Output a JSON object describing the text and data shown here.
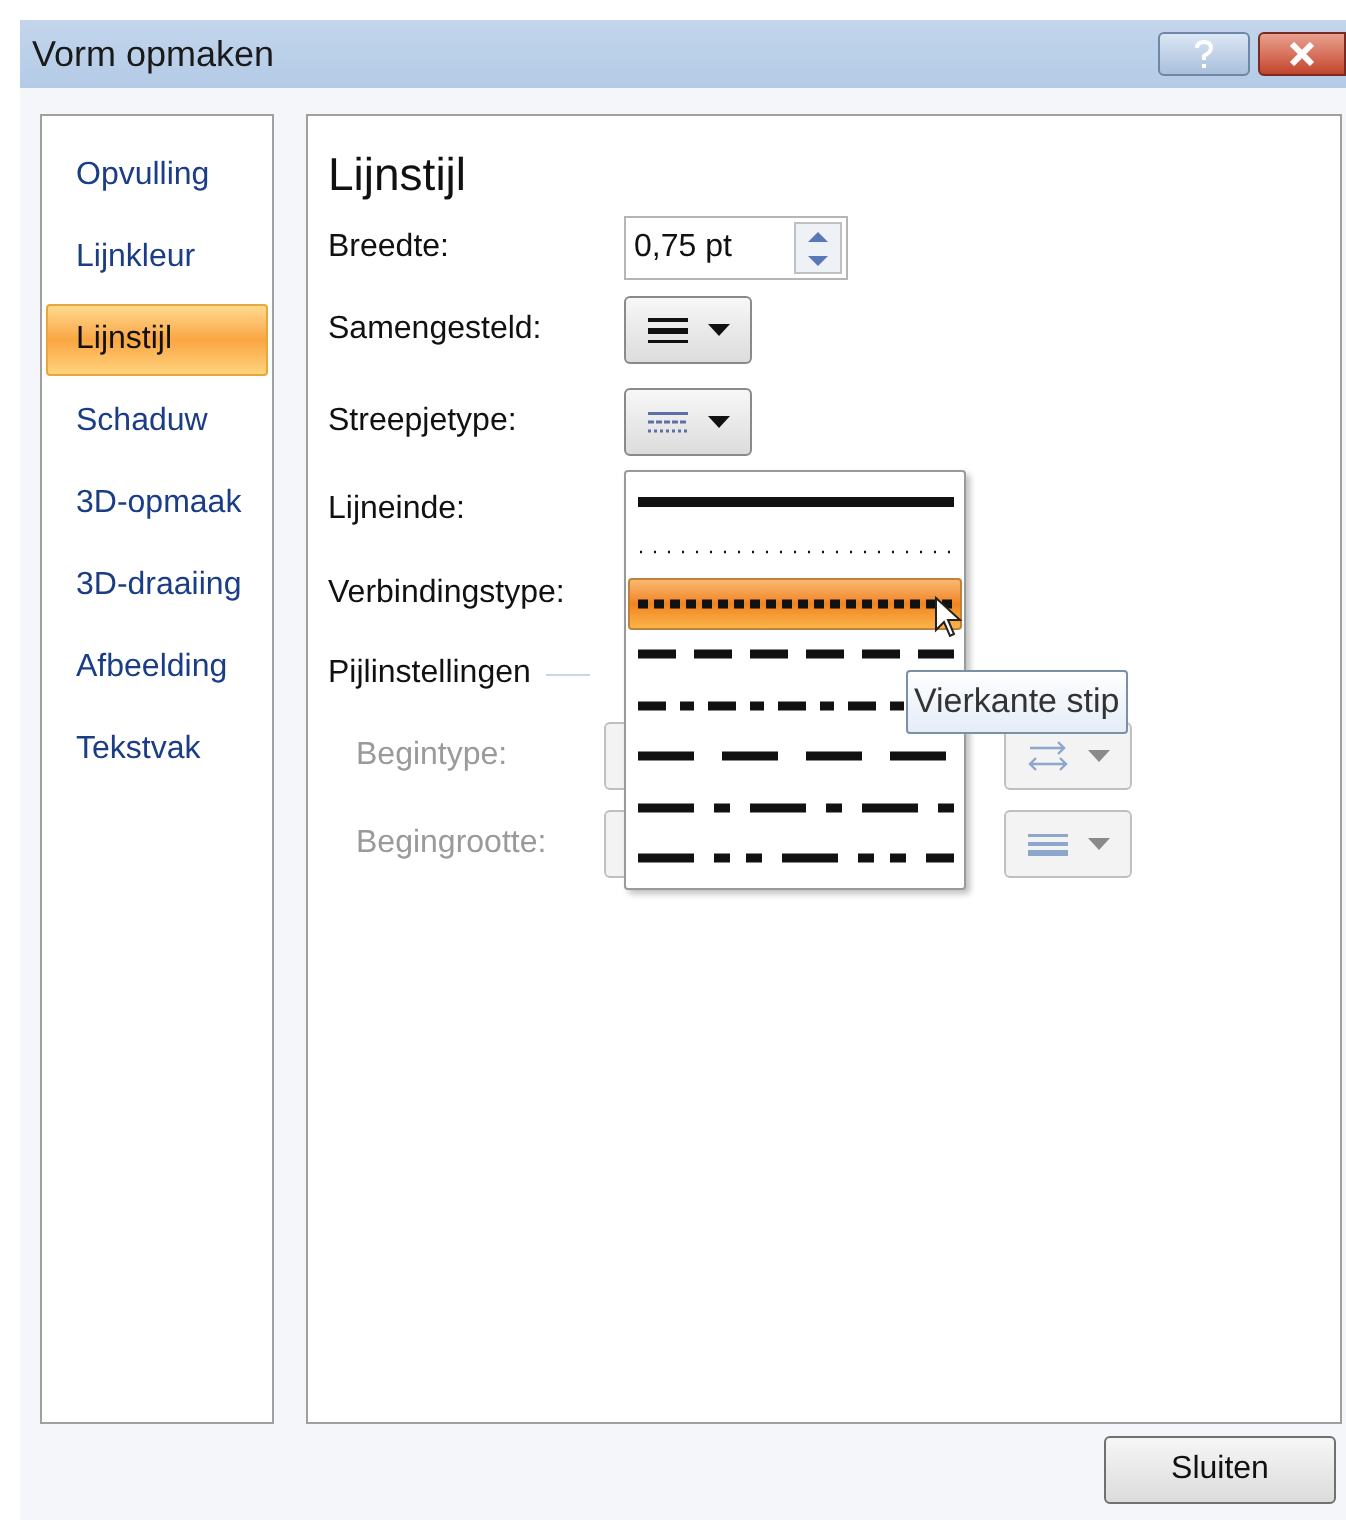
{
  "window": {
    "title": "Vorm opmaken"
  },
  "sidebar": {
    "items": [
      {
        "label": "Opvulling",
        "selected": false
      },
      {
        "label": "Lijnkleur",
        "selected": false
      },
      {
        "label": "Lijnstijl",
        "selected": true
      },
      {
        "label": "Schaduw",
        "selected": false
      },
      {
        "label": "3D-opmaak",
        "selected": false
      },
      {
        "label": "3D-draaiing",
        "selected": false
      },
      {
        "label": "Afbeelding",
        "selected": false
      },
      {
        "label": "Tekstvak",
        "selected": false
      }
    ]
  },
  "panel": {
    "title": "Lijnstijl",
    "fields": [
      {
        "kind": "spin",
        "label": "Breedte:",
        "value": "0,75 pt",
        "disabled": false
      },
      {
        "kind": "compound",
        "label": "Samengesteld:",
        "disabled": false
      },
      {
        "kind": "dash",
        "label": "Streepjetype:",
        "disabled": false
      },
      {
        "kind": "hidden",
        "label": "Lijneinde:",
        "disabled": false
      },
      {
        "kind": "hidden",
        "label": "Verbindingstype:",
        "disabled": false
      },
      {
        "kind": "section",
        "label": "Pijlinstellingen",
        "disabled": false
      },
      {
        "kind": "arrow-type",
        "label": "Begintype:",
        "disabled": true
      },
      {
        "kind": "arrow-size",
        "label": "Begingrootte:",
        "disabled": true
      }
    ]
  },
  "dash_menu": {
    "options": [
      {
        "kind": "solid",
        "selected": false
      },
      {
        "kind": "round-dot",
        "selected": false
      },
      {
        "kind": "square-dot",
        "selected": true
      },
      {
        "kind": "dash",
        "selected": false
      },
      {
        "kind": "dash-dot",
        "selected": false
      },
      {
        "kind": "long-dash",
        "selected": false
      },
      {
        "kind": "long-dash-dot",
        "selected": false
      },
      {
        "kind": "long-dash-dot-dot",
        "selected": false
      }
    ],
    "tooltip": "Vierkante stip"
  },
  "buttons": [
    {
      "label": "Sluiten"
    }
  ]
}
